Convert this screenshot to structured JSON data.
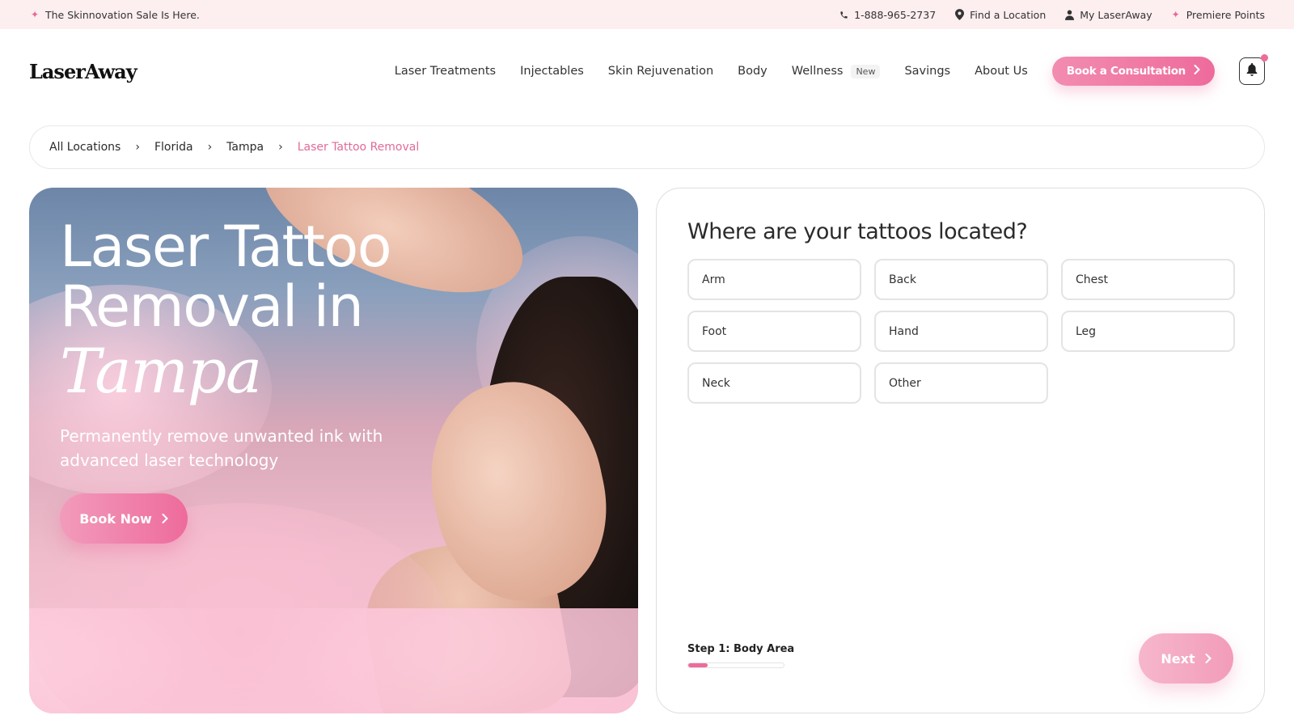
{
  "topbar": {
    "promo": "The Skinnovation Sale Is Here.",
    "phone": "1-888-965-2737",
    "find_location": "Find a Location",
    "account": "My LaserAway",
    "points": "Premiere Points"
  },
  "header": {
    "logo": "LaserAway",
    "nav": [
      "Laser Treatments",
      "Injectables",
      "Skin Rejuvenation",
      "Body",
      "Wellness",
      "Savings",
      "About Us"
    ],
    "wellness_badge": "New",
    "consult_button": "Book a Consultation"
  },
  "breadcrumb": [
    "All Locations",
    "Florida",
    "Tampa",
    "Laser Tattoo Removal"
  ],
  "hero": {
    "title_line1": "Laser Tattoo",
    "title_line2": "Removal in",
    "city": "Tampa",
    "subtitle": "Permanently remove unwanted ink with advanced laser technology",
    "book_button": "Book Now"
  },
  "quiz": {
    "question": "Where are your tattoos located?",
    "options": [
      "Arm",
      "Back",
      "Chest",
      "Foot",
      "Hand",
      "Leg",
      "Neck",
      "Other"
    ],
    "step_label": "Step 1: Body Area",
    "progress": 0.2,
    "next_button": "Next"
  },
  "colors": {
    "accent": "#ee6b9b",
    "promo_bg": "#fdeef0",
    "current_crumb": "#e06b98"
  },
  "icons": [
    "sparkle-icon",
    "phone-icon",
    "location-pin-icon",
    "user-icon",
    "chevron-right-icon",
    "bell-icon"
  ]
}
